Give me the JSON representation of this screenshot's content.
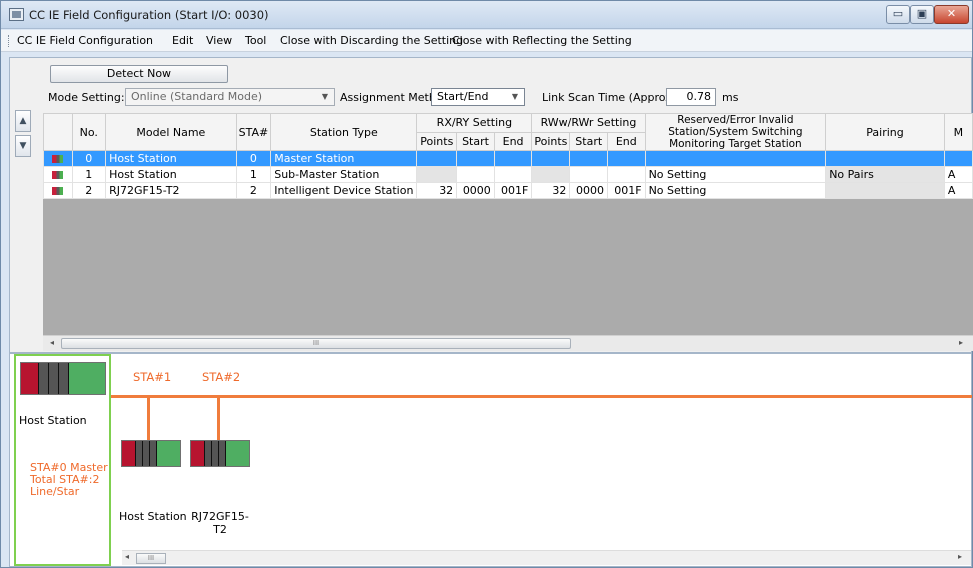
{
  "window": {
    "title": "CC IE Field Configuration (Start I/O: 0030)",
    "minimize": "▭",
    "maximize": "▣",
    "close": "✕"
  },
  "menu": [
    "CC IE Field Configuration",
    "Edit",
    "View",
    "Tool",
    "Close with Discarding the Setting",
    "Close with Reflecting the Setting"
  ],
  "toolbar": {
    "detect_now": "Detect Now",
    "mode_setting_label": "Mode Setting:",
    "mode_setting_value": "Online (Standard Mode)",
    "assignment_method_label": "Assignment Method:",
    "assignment_method_value": "Start/End",
    "link_scan_label": "Link Scan Time (Approx.):",
    "link_scan_value": "0.78",
    "link_scan_unit": "ms"
  },
  "side_buttons": [
    "▲",
    "▼"
  ],
  "table": {
    "headers": {
      "no": "No.",
      "model": "Model Name",
      "sta": "STA#",
      "type": "Station Type",
      "rxry": "RX/RY Setting",
      "rwwrwr": "RWw/RWr Setting",
      "points": "Points",
      "start": "Start",
      "end": "End",
      "reserved": "Reserved/Error Invalid Station/System Switching Monitoring Target Station",
      "pairing": "Pairing",
      "extra": "M"
    },
    "rows": [
      {
        "no": "0",
        "model": "Host Station",
        "sta": "0",
        "type": "Master Station",
        "rx_points": "",
        "rx_start": "",
        "rx_end": "",
        "rw_points": "",
        "rw_start": "",
        "rw_end": "",
        "reserved": "",
        "pairing": "",
        "extra": ""
      },
      {
        "no": "1",
        "model": "Host Station",
        "sta": "1",
        "type": "Sub-Master Station",
        "rx_points": "",
        "rx_start": "",
        "rx_end": "",
        "rw_points": "",
        "rw_start": "",
        "rw_end": "",
        "reserved": "No Setting",
        "pairing": "No Pairs",
        "extra": "A"
      },
      {
        "no": "2",
        "model": "RJ72GF15-T2",
        "sta": "2",
        "type": "Intelligent Device Station",
        "rx_points": "32",
        "rx_start": "0000",
        "rx_end": "001F",
        "rw_points": "32",
        "rw_start": "0000",
        "rw_end": "001F",
        "reserved": "No Setting",
        "pairing": "",
        "extra": "A"
      }
    ]
  },
  "scroll": {
    "left": "◂",
    "right": "▸",
    "grip": "III"
  },
  "diagram": {
    "host_label": "Host Station",
    "host_info": [
      "STA#0  Master",
      "Total STA#:2",
      "Line/Star"
    ],
    "sta1_label": "STA#1",
    "sta2_label": "STA#2",
    "sta1_name": "Host Station",
    "sta2_name_line1": "RJ72GF15-",
    "sta2_name_line2": "T2",
    "line_color": "#f07c3c",
    "highlight_color": "#7fd04f"
  }
}
